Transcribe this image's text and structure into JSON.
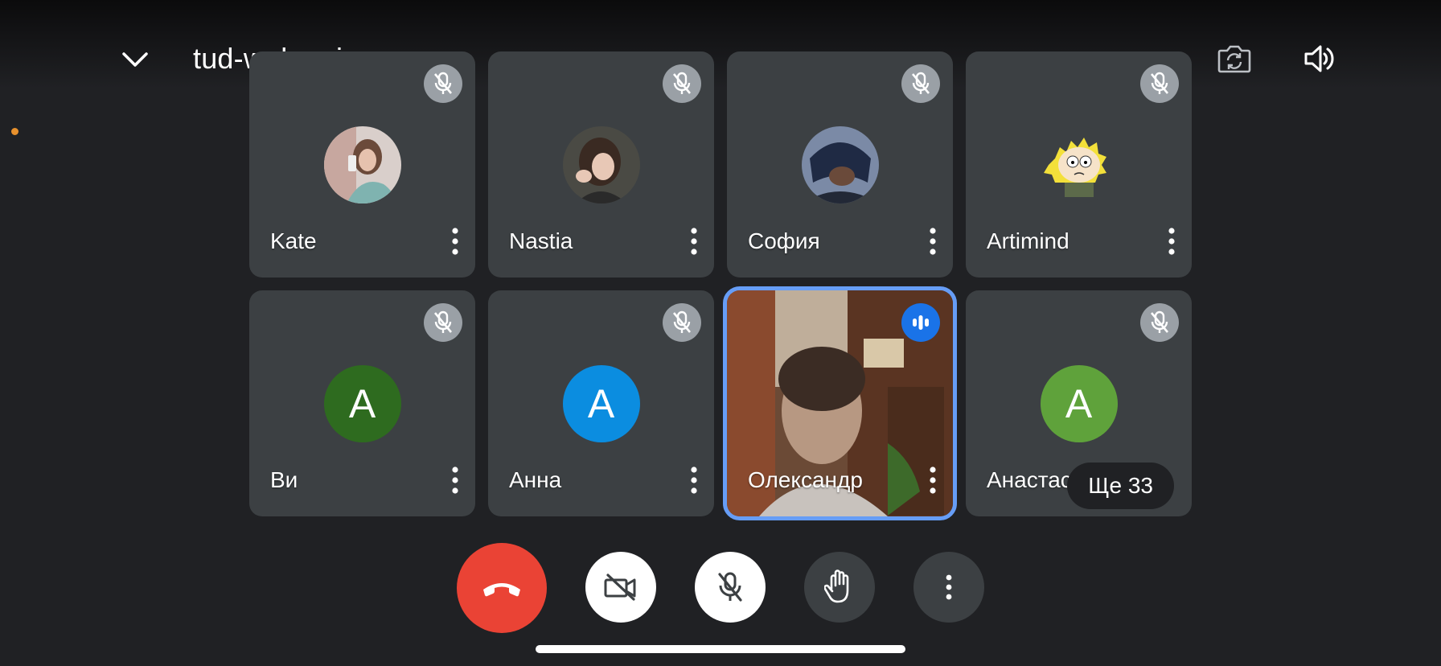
{
  "meeting": {
    "code": "tud-wnkv-ujp"
  },
  "participants": [
    {
      "name": "Kate",
      "avatar_type": "photo",
      "muted": true
    },
    {
      "name": "Nastia",
      "avatar_type": "photo",
      "muted": true
    },
    {
      "name": "София",
      "avatar_type": "photo",
      "muted": true
    },
    {
      "name": "Artimind",
      "avatar_type": "photo",
      "muted": true
    },
    {
      "name": "Ви",
      "avatar_type": "letter",
      "letter": "А",
      "color": "#2e6b1f",
      "muted": true
    },
    {
      "name": "Анна",
      "avatar_type": "letter",
      "letter": "А",
      "color": "#0b8de0",
      "muted": true
    },
    {
      "name": "Олександр",
      "avatar_type": "video",
      "muted": false,
      "speaking": true
    },
    {
      "name": "Анастасия",
      "avatar_type": "letter",
      "letter": "А",
      "color": "#5fa23b",
      "muted": true
    }
  ],
  "more_people_label": "Ще 33",
  "icons": {
    "collapse": "chevron-down-icon",
    "title_caret": "caret-right-icon",
    "flip_camera": "flip-camera-icon",
    "speaker": "volume-icon",
    "mute": "mic-off-icon",
    "speaking": "audio-bars-icon",
    "more": "more-vert-icon",
    "end_call": "call-end-icon",
    "camera_off": "videocam-off-icon",
    "mic_off": "mic-off-icon",
    "raise_hand": "hand-icon",
    "options": "more-vert-icon"
  },
  "colors": {
    "background": "#202124",
    "tile": "#3c4043",
    "active_outline": "#669df6",
    "speaking_badge": "#1a73e8",
    "end_call": "#ea4335"
  }
}
